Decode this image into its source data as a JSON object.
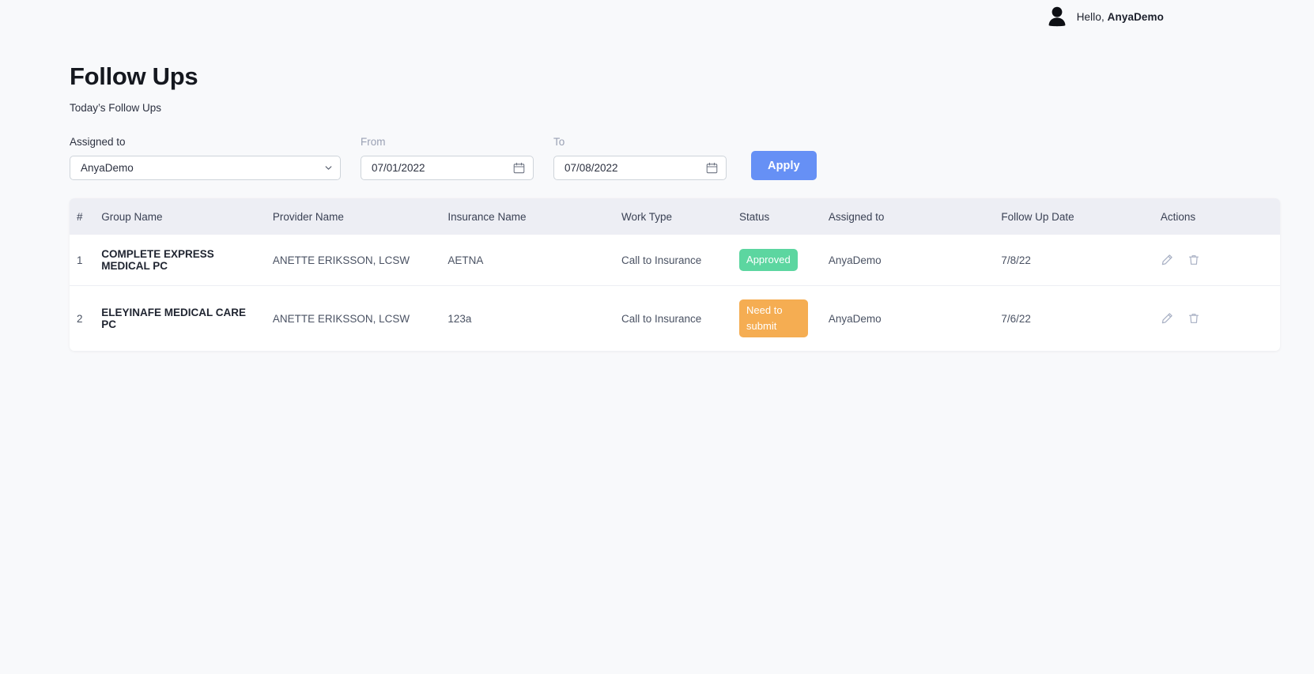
{
  "header": {
    "greeting_prefix": "Hello,",
    "user_name": "AnyaDemo",
    "avatar_icon": "user-silhouette-icon"
  },
  "page": {
    "title": "Follow Ups",
    "subtitle": "Today’s Follow Ups"
  },
  "filters": {
    "assigned_to": {
      "label": "Assigned to",
      "value": "AnyaDemo",
      "options": [
        "AnyaDemo"
      ],
      "chevron_icon": "chevron-down-icon"
    },
    "from": {
      "label": "From",
      "value": "07/01/2022",
      "calendar_icon": "calendar-icon"
    },
    "to": {
      "label": "To",
      "value": "07/08/2022",
      "calendar_icon": "calendar-icon"
    },
    "apply_label": "Apply",
    "apply_color": "#6690f5"
  },
  "table": {
    "columns": [
      "#",
      "Group Name",
      "Provider Name",
      "Insurance Name",
      "Work Type",
      "Status",
      "Assigned to",
      "Follow Up Date",
      "Actions"
    ],
    "rows": [
      {
        "num": "1",
        "group_name": "COMPLETE EXPRESS MEDICAL PC",
        "provider_name": "ANETTE ERIKSSON, LCSW",
        "insurance_name": "AETNA",
        "work_type": "Call to Insurance",
        "status": "Approved",
        "status_color": "#5cd6a0",
        "assigned_to": "AnyaDemo",
        "follow_up_date": "7/8/22",
        "edit_icon": "pencil-icon",
        "delete_icon": "trash-icon"
      },
      {
        "num": "2",
        "group_name": "ELEYINAFE MEDICAL CARE PC",
        "provider_name": "ANETTE ERIKSSON, LCSW",
        "insurance_name": "123a",
        "work_type": "Call to Insurance",
        "status": "Need to submit",
        "status_color": "#f5ad52",
        "assigned_to": "AnyaDemo",
        "follow_up_date": "7/6/22",
        "edit_icon": "pencil-icon",
        "delete_icon": "trash-icon"
      }
    ]
  }
}
